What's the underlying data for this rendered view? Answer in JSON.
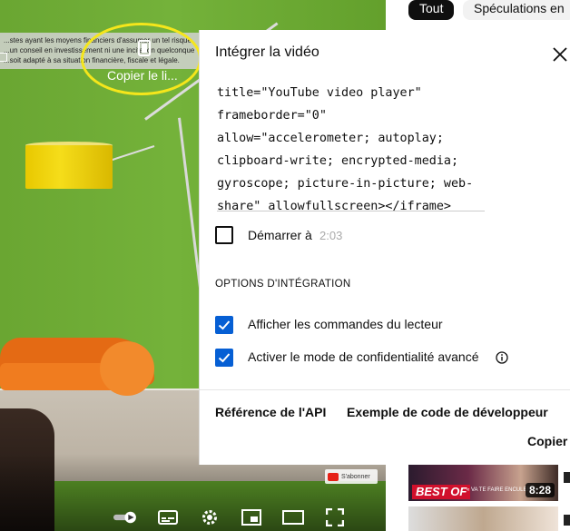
{
  "player": {
    "disclaimer_text": "...stes ayant les moyens financiers d'assumer un tel risque. ...un conseil en investissement ni une incitation quelconque ...soit adapté à sa situation financière, fiscale et légale.",
    "copy_link_label": "Copier le li...",
    "subscribe_label": "S'abonner",
    "controls": [
      "autoplay-toggle-icon",
      "subtitles-icon",
      "settings-gear-icon",
      "miniplayer-icon",
      "theater-mode-icon",
      "fullscreen-icon"
    ]
  },
  "feed": {
    "chips": [
      "Tout",
      "Spéculations en"
    ],
    "video1": {
      "badge": "BEST OF",
      "caption": "« VA TE FAIRE ENCULER ! »",
      "duration": "8:28"
    }
  },
  "modal": {
    "title": "Intégrer la vidéo",
    "code_lines": [
      "title=\"YouTube video player\"",
      "frameborder=\"0\"",
      "allow=\"accelerometer; autoplay;",
      "clipboard-write; encrypted-media;",
      "gyroscope; picture-in-picture; web-",
      "share\" allowfullscreen></iframe>"
    ],
    "start_at_label": "Démarrer à",
    "start_at_time": "2:03",
    "options_title": "OPTIONS D'INTÉGRATION",
    "option_controls_label": "Afficher les commandes du lecteur",
    "option_privacy_label": "Activer le mode de confidentialité avancé",
    "api_link": "Référence de l'API",
    "dev_code_link": "Exemple de code de développeur",
    "copy_button": "Copier"
  },
  "colors": {
    "accent": "#065fd4",
    "annotation": "#f5e61b",
    "wall": "#6aa632",
    "sofa": "#f07c1f"
  }
}
